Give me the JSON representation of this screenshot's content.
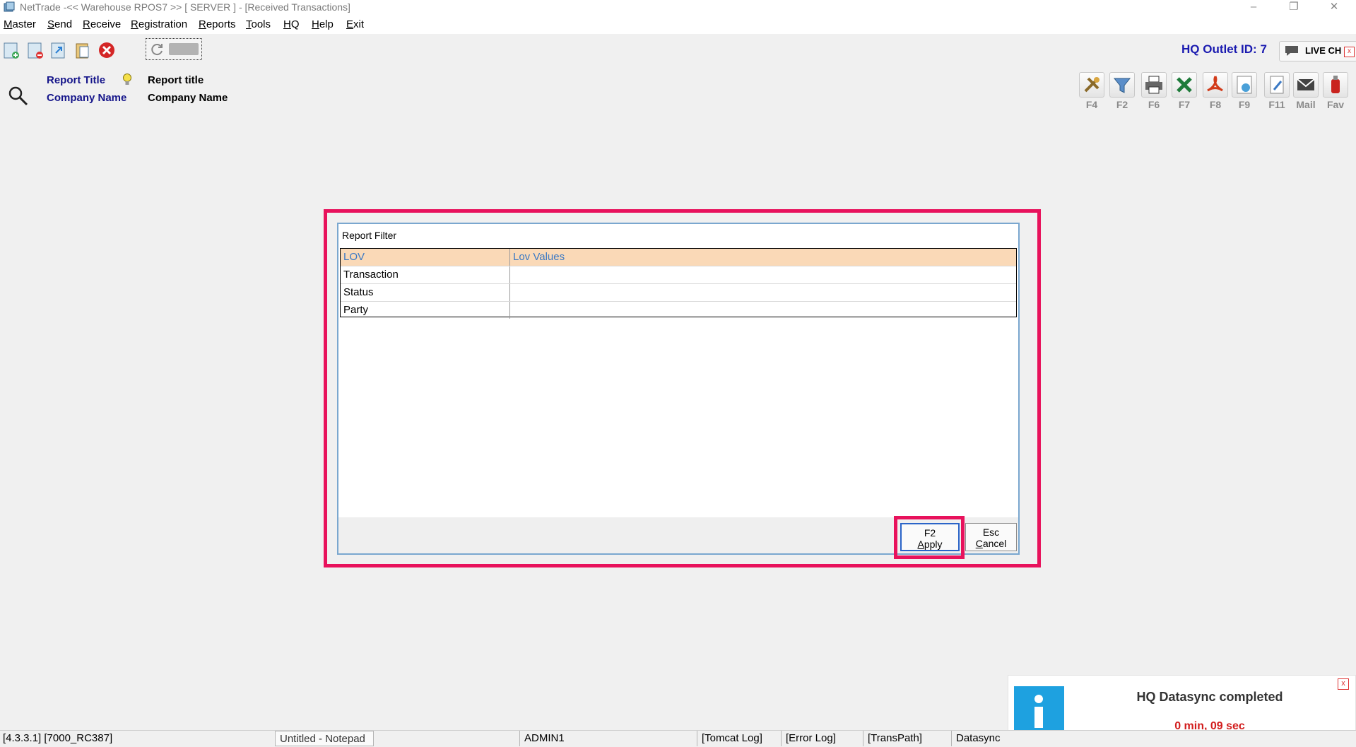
{
  "window": {
    "title": "NetTrade -<< Warehouse RPOS7 >> [ SERVER ]  - [Received Transactions]",
    "minimize": "–",
    "restore": "❐",
    "close": "✕"
  },
  "menu": [
    "Master",
    "Send",
    "Receive",
    "Registration",
    "Reports",
    "Tools",
    "HQ",
    "Help",
    "Exit"
  ],
  "toolbar": {
    "hq_outlet": "HQ Outlet ID: 7",
    "live_chat": "LIVE CH",
    "live_chat_close": "x"
  },
  "header": {
    "report_title_label": "Report Title",
    "report_title_value": "Report title",
    "company_name_label": "Company Name",
    "company_name_value": "Company Name"
  },
  "function_keys": [
    "F4",
    "F2",
    "F6",
    "F7",
    "F8",
    "F9",
    "F11",
    "Mail",
    "Fav"
  ],
  "dialog": {
    "title": "Report Filter",
    "columns": [
      "LOV",
      "Lov Values"
    ],
    "rows": [
      {
        "lov": "Transaction",
        "value": ""
      },
      {
        "lov": "Status",
        "value": ""
      },
      {
        "lov": "Party",
        "value": ""
      }
    ],
    "apply_key": "F2",
    "apply_label": "Apply",
    "cancel_key": "Esc",
    "cancel_label": "Cancel"
  },
  "toast": {
    "title": "HQ Datasync completed",
    "time": "0 min, 09 sec",
    "close": "x"
  },
  "status": {
    "version": "[4.3.3.1] [7000_RC387]",
    "notepad": "Untitled - Notepad",
    "user": "ADMIN1",
    "tomcat": "[Tomcat Log]",
    "error": "[Error Log]",
    "transpath": "[TransPath]",
    "datasync": "Datasync"
  },
  "colors": {
    "highlight": "#e8125c",
    "header_label": "#15158a",
    "grid_header_bg": "#fad9b7",
    "grid_header_text": "#3b79c4",
    "toast_time": "#d21d1d"
  }
}
